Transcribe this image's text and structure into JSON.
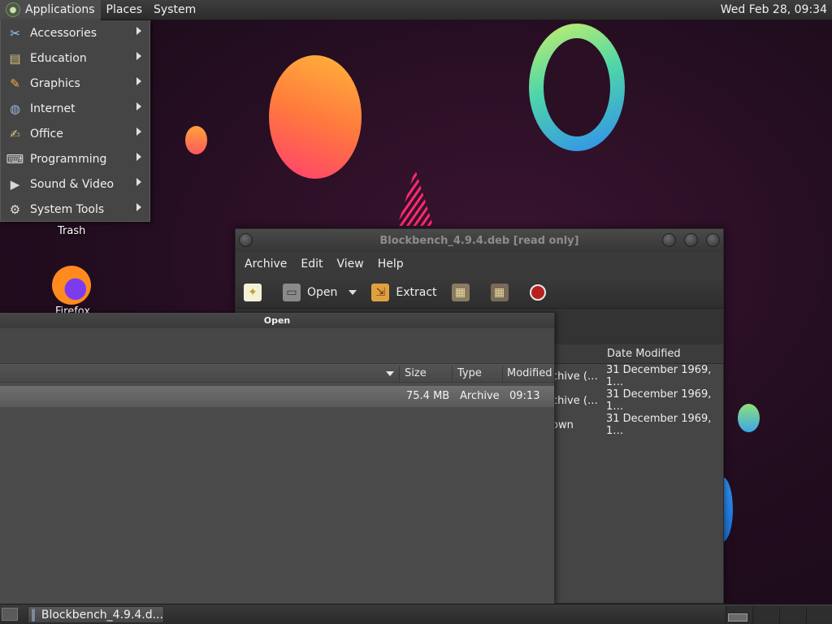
{
  "top_panel": {
    "applications": "Applications",
    "places": "Places",
    "system": "System",
    "clock": "Wed Feb 28, 09:34"
  },
  "apps_menu": {
    "items": [
      {
        "label": "Accessories",
        "icon": "accessories-icon"
      },
      {
        "label": "Education",
        "icon": "education-icon"
      },
      {
        "label": "Graphics",
        "icon": "graphics-icon"
      },
      {
        "label": "Internet",
        "icon": "internet-icon"
      },
      {
        "label": "Office",
        "icon": "office-icon"
      },
      {
        "label": "Programming",
        "icon": "programming-icon"
      },
      {
        "label": "Sound & Video",
        "icon": "sound-video-icon"
      },
      {
        "label": "System Tools",
        "icon": "system-tools-icon"
      }
    ]
  },
  "desktop": {
    "trash_label": "Trash",
    "firefox_label": "Firefox"
  },
  "archive_window": {
    "title": "Blockbench_4.9.4.deb [read only]",
    "menu": [
      "Archive",
      "Edit",
      "View",
      "Help"
    ],
    "toolbar": {
      "open": "Open",
      "extract": "Extract"
    },
    "columns": {
      "date_modified": "Date Modified"
    },
    "rows": [
      {
        "type": "chive (…",
        "date": "31 December 1969, 1…"
      },
      {
        "type": "chive (…",
        "date": "31 December 1969, 1…"
      },
      {
        "type": "own",
        "date": "31 December 1969, 1…"
      }
    ]
  },
  "open_dialog": {
    "title": "Open",
    "columns": {
      "size": "Size",
      "type": "Type",
      "modified": "Modified"
    },
    "row": {
      "size": "75.4 MB",
      "type": "Archive",
      "modified": "09:13"
    }
  },
  "taskbar": {
    "task_label": "Blockbench_4.9.4.d..."
  }
}
